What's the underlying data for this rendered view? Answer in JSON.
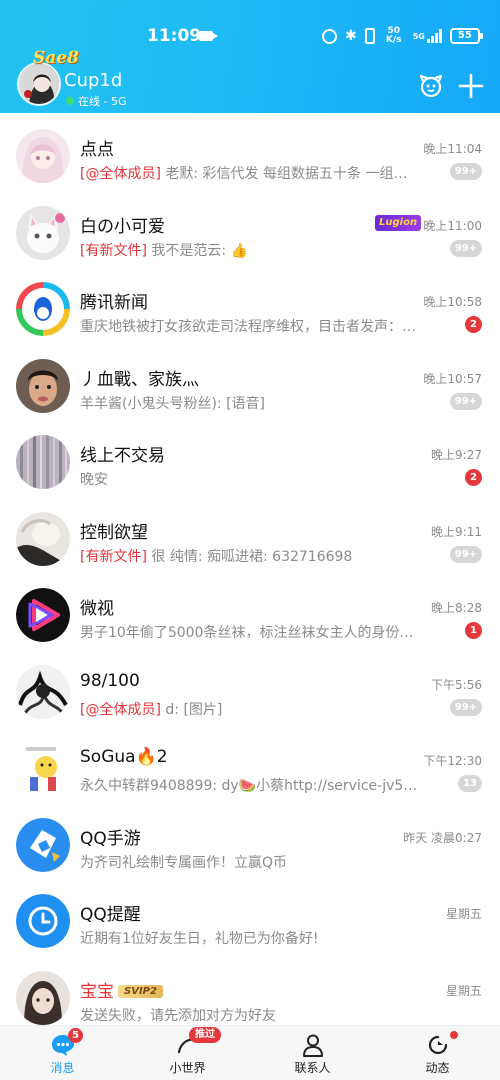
{
  "status_bar": {
    "time": "11:09",
    "net_speed_top": "50",
    "net_speed_unit": "K/s",
    "battery": "55",
    "network_type": "5G"
  },
  "profile": {
    "badge_text": "Sae8",
    "name": "Cup1d",
    "status": "在线 - 5G"
  },
  "conversations": [
    {
      "name": "点点",
      "time": "晚上11:04",
      "tag": "[@全体成员]",
      "preview": " 老默: 彩信代发  每组数据五十条  一组…",
      "badge": "99+",
      "badge_style": "grey",
      "avatar": "anime-girl-avatar"
    },
    {
      "name": "白の小可爱",
      "time": "晚上11:00",
      "tag": "[有新文件]",
      "preview": " 我不是范云: 👍",
      "badge": "99+",
      "badge_style": "grey",
      "chip": "Lugion",
      "avatar": "cat-avatar"
    },
    {
      "name": "腾讯新闻",
      "time": "晚上10:58",
      "tag": "",
      "preview": "重庆地铁被打女孩欲走司法程序维权，目击者发声：…",
      "badge": "2",
      "badge_style": "red",
      "avatar": "tencent-news-logo"
    },
    {
      "name": "丿血戰、家族灬",
      "time": "晚上10:57",
      "tag": "",
      "preview": "羊羊酱(小鬼头号粉丝): [语音]",
      "badge": "99+",
      "badge_style": "grey",
      "avatar": "man-avatar"
    },
    {
      "name": "线上不交易",
      "time": "晚上9:27",
      "tag": "",
      "preview": "晚安",
      "badge": "2",
      "badge_style": "red",
      "avatar": "striped-avatar"
    },
    {
      "name": "控制欲望",
      "time": "晚上9:11",
      "tag": "[有新文件]",
      "preview": " 很 纯情: 痴呱进裙:  632716698",
      "badge": "99+",
      "badge_style": "grey",
      "avatar": "photo-avatar"
    },
    {
      "name": "微视",
      "time": "晚上8:28",
      "tag": "",
      "preview": "男子10年偷了5000条丝袜，标注丝袜女主人的身份…",
      "badge": "1",
      "badge_style": "red",
      "avatar": "weishi-logo"
    },
    {
      "name": "98/100",
      "time": "下午5:56",
      "tag": "[@全体成员]",
      "preview": " d: [图片]",
      "badge": "99+",
      "badge_style": "grey",
      "avatar": "sketch-avatar"
    },
    {
      "name": "SoGua🔥2",
      "time": "下午12:30",
      "tag": "",
      "preview": "永久中转群9408899: dy🍉小蔡http://service-jv5g5…",
      "badge": "13",
      "badge_style": "grey",
      "avatar": "cartoon-avatar"
    },
    {
      "name": "QQ手游",
      "time": "昨天 凌晨0:27",
      "tag": "",
      "preview": "为齐司礼绘制专属画作！立赢Q币",
      "badge": "",
      "badge_style": "",
      "avatar": "qq-games-logo"
    },
    {
      "name": "QQ提醒",
      "time": "星期五",
      "tag": "",
      "preview": "近期有1位好友生日，礼物已为你备好!",
      "badge": "",
      "badge_style": "",
      "avatar": "qq-reminder-logo"
    },
    {
      "name": "宝宝",
      "time": "星期五",
      "tag": "",
      "preview": "发送失败，请先添加对方为好友",
      "badge": "",
      "badge_style": "",
      "svip": "SVIP2",
      "name_red": true,
      "avatar": "girl-avatar"
    }
  ],
  "tabs": [
    {
      "label": "消息",
      "badge": "5"
    },
    {
      "label": "小世界",
      "pill": "推过"
    },
    {
      "label": "联系人"
    },
    {
      "label": "动态"
    }
  ],
  "colors": {
    "header_gradient_start": "#22c3f0",
    "header_gradient_end": "#15a8f7",
    "accent": "#1a9df3",
    "alert_red": "#e4393c",
    "badge_grey": "#d7d7d7"
  }
}
